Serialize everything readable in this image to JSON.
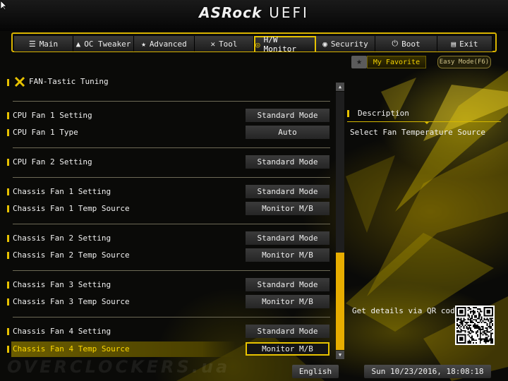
{
  "header": {
    "brand": "ASRock",
    "product": "UEFI"
  },
  "tabs": [
    {
      "label": "Main",
      "icon": "list-icon",
      "glyph": "☰"
    },
    {
      "label": "OC Tweaker",
      "icon": "rocket-icon",
      "glyph": "▲"
    },
    {
      "label": "Advanced",
      "icon": "star-icon",
      "glyph": "★"
    },
    {
      "label": "Tool",
      "icon": "wrench-icon",
      "glyph": "✕"
    },
    {
      "label": "H/W Monitor",
      "icon": "gauge-icon",
      "glyph": "◎"
    },
    {
      "label": "Security",
      "icon": "shield-icon",
      "glyph": "◉"
    },
    {
      "label": "Boot",
      "icon": "power-icon",
      "glyph": "⏻"
    },
    {
      "label": "Exit",
      "icon": "exit-door-icon",
      "glyph": "▤"
    }
  ],
  "active_tab": "H/W Monitor",
  "favorite": {
    "label": "My Favorite",
    "star_icon": "star-icon"
  },
  "easy_mode": {
    "label": "Easy Mode(F6)"
  },
  "section": {
    "title": "FAN-Tastic Tuning",
    "icon": "fan-tuning-tools-icon"
  },
  "settings": [
    {
      "label": "CPU Fan 1 Setting",
      "value": "Standard Mode"
    },
    {
      "label": "CPU Fan 1 Type",
      "value": "Auto"
    },
    {
      "label": "CPU Fan 2 Setting",
      "value": "Standard Mode"
    },
    {
      "label": "Chassis Fan 1 Setting",
      "value": "Standard Mode"
    },
    {
      "label": "Chassis Fan 1 Temp Source",
      "value": "Monitor M/B"
    },
    {
      "label": "Chassis Fan 2 Setting",
      "value": "Standard Mode"
    },
    {
      "label": "Chassis Fan 2 Temp Source",
      "value": "Monitor M/B"
    },
    {
      "label": "Chassis Fan 3 Setting",
      "value": "Standard Mode"
    },
    {
      "label": "Chassis Fan 3 Temp Source",
      "value": "Monitor M/B"
    },
    {
      "label": "Chassis Fan 4 Setting",
      "value": "Standard Mode"
    },
    {
      "label": "Chassis Fan 4 Temp Source",
      "value": "Monitor M/B",
      "selected": true
    }
  ],
  "description": {
    "title": "Description",
    "text": "Select Fan Temperature Source"
  },
  "qr": {
    "label": "Get details via QR code"
  },
  "watermark": "OVERCLOCKERS.ua",
  "footer": {
    "language": "English",
    "datetime": "Sun 10/23/2016, 18:08:18"
  },
  "colors": {
    "accent": "#e7c200",
    "scroll_thumb": "#e7ad00",
    "background": "#080808"
  }
}
